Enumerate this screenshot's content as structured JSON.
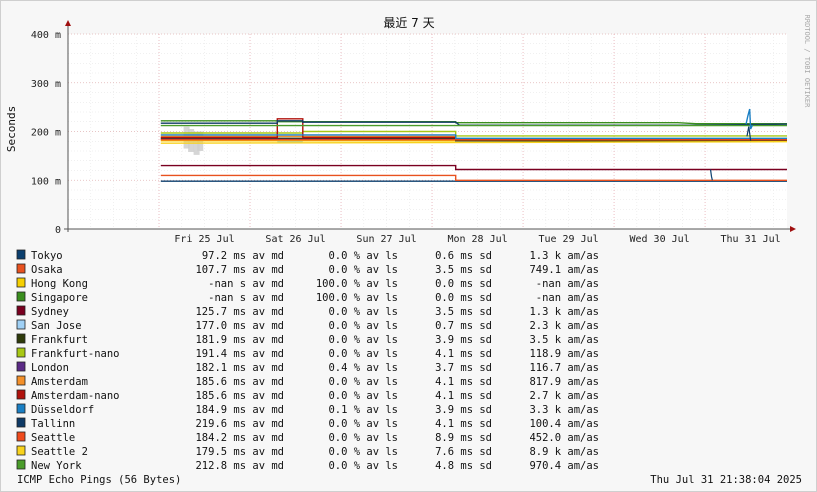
{
  "chart_data": {
    "type": "line",
    "title": "最近 7 天",
    "ylabel": "Seconds",
    "side_label": "RRDTOOL / TOBI OETIKER",
    "ylim": [
      0,
      400
    ],
    "yticks": [
      {
        "value": 0,
        "label": "0"
      },
      {
        "value": 100,
        "label": "100 m"
      },
      {
        "value": 200,
        "label": "200 m"
      },
      {
        "value": 300,
        "label": "300 m"
      },
      {
        "value": 400,
        "label": "400 m"
      }
    ],
    "x_unit": "days from Thu 24 Jul 00:00",
    "xlim": [
      0,
      7.9
    ],
    "xticks": [
      {
        "value": 1.5,
        "label": "Fri 25 Jul"
      },
      {
        "value": 2.5,
        "label": "Sat 26 Jul"
      },
      {
        "value": 3.5,
        "label": "Sun 27 Jul"
      },
      {
        "value": 4.5,
        "label": "Mon 28 Jul"
      },
      {
        "value": 5.5,
        "label": "Tue 29 Jul"
      },
      {
        "value": 6.5,
        "label": "Wed 30 Jul"
      },
      {
        "value": 7.5,
        "label": "Thu 31 Jul"
      }
    ],
    "day_boundaries": [
      1,
      2,
      3,
      4,
      5,
      6,
      7
    ],
    "grid": true,
    "series": [
      {
        "name": "Tokyo",
        "color": "#0b3f6e",
        "avg": "97.2 ms av md",
        "loss": "0.0 % av ls",
        "sd": "0.6 ms sd",
        "ams": "1.3 k am/as",
        "points": [
          [
            1.02,
            98
          ],
          [
            7.9,
            98
          ]
        ]
      },
      {
        "name": "Osaka",
        "color": "#e8511f",
        "avg": "107.7 ms av md",
        "loss": "0.0 % av ls",
        "sd": "3.5 ms sd",
        "ams": "749.1   am/as",
        "points": [
          [
            1.02,
            110
          ],
          [
            4.26,
            110
          ],
          [
            4.26,
            100
          ],
          [
            7.9,
            100
          ]
        ]
      },
      {
        "name": "Hong Kong",
        "color": "#f5cf00",
        "avg": "-nan  s av md",
        "loss": "100.0 % av ls",
        "sd": "0.0 ms sd",
        "ams": "-nan   am/as",
        "points": [
          [
            1.02,
            181
          ],
          [
            7.9,
            181
          ]
        ]
      },
      {
        "name": "Singapore",
        "color": "#3a8e1e",
        "avg": "-nan  s av md",
        "loss": "100.0 % av ls",
        "sd": "0.0 ms sd",
        "ams": "-nan   am/as",
        "points": [
          [
            1.02,
            222
          ],
          [
            2.3,
            222
          ],
          [
            2.3,
            220
          ],
          [
            4.26,
            220
          ],
          [
            4.26,
            218
          ],
          [
            6.7,
            218
          ],
          [
            6.9,
            216
          ],
          [
            7.9,
            216
          ]
        ]
      },
      {
        "name": "Sydney",
        "color": "#7a0020",
        "avg": "125.7 ms av md",
        "loss": "0.0 % av ls",
        "sd": "3.5 ms sd",
        "ams": "1.3 k am/as",
        "points": [
          [
            1.02,
            130
          ],
          [
            4.26,
            130
          ],
          [
            4.26,
            122
          ],
          [
            7.9,
            122
          ]
        ]
      },
      {
        "name": "San Jose",
        "color": "#9fd0f5",
        "avg": "177.0 ms av md",
        "loss": "0.0 % av ls",
        "sd": "0.7 ms sd",
        "ams": "2.3 k am/as",
        "points": [
          [
            2.3,
            178
          ],
          [
            2.58,
            178
          ]
        ]
      },
      {
        "name": "Frankfurt",
        "color": "#2e3a0a",
        "avg": "181.9 ms av md",
        "loss": "0.0 % av ls",
        "sd": "3.9 ms sd",
        "ams": "3.5 k am/as",
        "points": [
          [
            1.02,
            186
          ],
          [
            4.26,
            186
          ],
          [
            4.26,
            181
          ],
          [
            7.9,
            181
          ]
        ]
      },
      {
        "name": "Frankfurt-nano",
        "color": "#a8c814",
        "avg": "191.4 ms av md",
        "loss": "0.0 % av ls",
        "sd": "4.1 ms sd",
        "ams": "118.9   am/as",
        "points": [
          [
            1.02,
            197
          ],
          [
            2.58,
            197
          ],
          [
            2.58,
            200
          ],
          [
            4.26,
            200
          ],
          [
            4.26,
            191
          ],
          [
            7.9,
            191
          ]
        ]
      },
      {
        "name": "London",
        "color": "#5b2a86",
        "avg": "182.1 ms av md",
        "loss": "0.4 % av ls",
        "sd": "3.7 ms sd",
        "ams": "116.7   am/as",
        "points": [
          [
            1.02,
            184
          ],
          [
            7.9,
            183
          ]
        ]
      },
      {
        "name": "Amsterdam",
        "color": "#f4902a",
        "avg": "185.6 ms av md",
        "loss": "0.0 % av ls",
        "sd": "4.1 ms sd",
        "ams": "817.9   am/as",
        "points": [
          [
            1.02,
            190
          ],
          [
            4.26,
            190
          ],
          [
            4.26,
            185
          ],
          [
            7.9,
            185
          ]
        ]
      },
      {
        "name": "Amsterdam-nano",
        "color": "#b0120c",
        "avg": "185.6 ms av md",
        "loss": "0.0 % av ls",
        "sd": "4.1 ms sd",
        "ams": "2.7 k am/as",
        "points": [
          [
            1.02,
            188
          ],
          [
            2.3,
            188
          ],
          [
            2.3,
            226
          ],
          [
            2.58,
            226
          ],
          [
            2.58,
            188
          ],
          [
            4.26,
            188
          ],
          [
            4.26,
            184
          ],
          [
            7.9,
            184
          ]
        ]
      },
      {
        "name": "Düsseldorf",
        "color": "#1a7fc4",
        "avg": "184.9 ms av md",
        "loss": "0.1 % av ls",
        "sd": "3.9 ms sd",
        "ams": "3.3 k am/as",
        "points": [
          [
            1.02,
            193
          ],
          [
            4.26,
            193
          ],
          [
            4.26,
            186
          ],
          [
            7.9,
            186
          ]
        ]
      },
      {
        "name": "Tallinn",
        "color": "#0f3a66",
        "avg": "219.6 ms av md",
        "loss": "0.0 % av ls",
        "sd": "4.1 ms sd",
        "ams": "100.4   am/as",
        "points": [
          [
            1.02,
            217
          ],
          [
            2.3,
            217
          ],
          [
            2.3,
            222
          ],
          [
            2.58,
            222
          ],
          [
            2.58,
            219
          ],
          [
            4.26,
            219
          ],
          [
            4.3,
            213
          ],
          [
            6.9,
            213
          ],
          [
            7.9,
            215
          ]
        ]
      },
      {
        "name": "Seattle",
        "color": "#ef4a1c",
        "avg": "184.2 ms av md",
        "loss": "0.0 % av ls",
        "sd": "8.9 ms sd",
        "ams": "452.0   am/as",
        "points": [
          [
            1.02,
            183
          ],
          [
            7.9,
            183
          ]
        ]
      },
      {
        "name": "Seattle 2",
        "color": "#f8d21c",
        "avg": "179.5 ms av md",
        "loss": "0.0 % av ls",
        "sd": "7.6 ms sd",
        "ams": "8.9 k am/as",
        "points": [
          [
            1.02,
            176
          ],
          [
            7.9,
            179
          ]
        ]
      },
      {
        "name": "New York",
        "color": "#4a9c2a",
        "avg": "212.8 ms av md",
        "loss": "0.0 % av ls",
        "sd": "4.8 ms sd",
        "ams": "970.4   am/as",
        "points": [
          [
            1.02,
            212
          ],
          [
            7.9,
            212
          ]
        ]
      }
    ],
    "footer_left": "ICMP Echo Pings (56 Bytes)",
    "footer_right": "Thu Jul 31 21:38:04 2025"
  }
}
